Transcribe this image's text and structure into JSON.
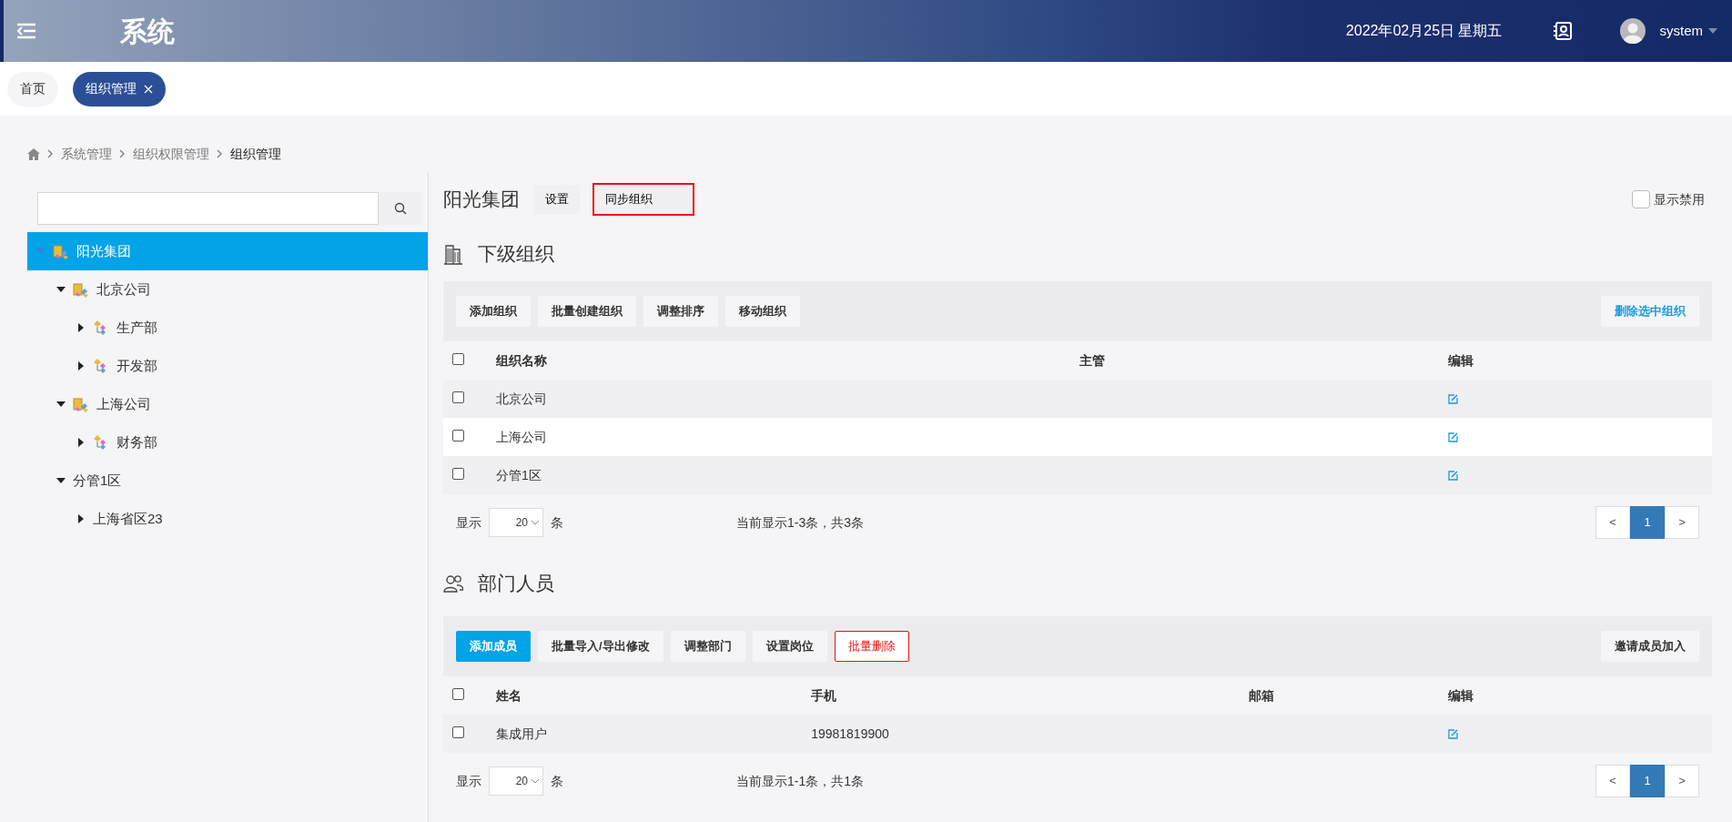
{
  "header": {
    "title": "系统",
    "date": "2022年02月25日 星期五",
    "user": "system"
  },
  "tabs": [
    {
      "label": "首页",
      "selected": false,
      "closable": false
    },
    {
      "label": "组织管理",
      "selected": true,
      "closable": true
    }
  ],
  "breadcrumb": [
    "系统管理",
    "组织权限管理",
    "组织管理"
  ],
  "tree": [
    {
      "label": "阳光集团",
      "kind": "company",
      "expanded": true,
      "selected": true,
      "children": [
        {
          "label": "北京公司",
          "kind": "company",
          "expanded": true,
          "selected": false,
          "children": [
            {
              "label": "生产部",
              "kind": "department",
              "expanded": false,
              "selected": false
            },
            {
              "label": "开发部",
              "kind": "department",
              "expanded": false,
              "selected": false
            }
          ]
        },
        {
          "label": "上海公司",
          "kind": "company",
          "expanded": true,
          "selected": false,
          "children": [
            {
              "label": "财务部",
              "kind": "department",
              "expanded": false,
              "selected": false
            }
          ]
        },
        {
          "label": "分管1区",
          "kind": "plain",
          "expanded": true,
          "selected": false,
          "children": [
            {
              "label": "上海省区23",
              "kind": "plain",
              "expanded": false,
              "selected": false
            }
          ]
        }
      ]
    }
  ],
  "org": {
    "title": "阳光集团",
    "actions": [
      {
        "label": "设置",
        "highlighted": false
      },
      {
        "label": "同步组织",
        "highlighted": true
      }
    ],
    "show_disabled": {
      "label": "显示禁用",
      "checked": false
    }
  },
  "sections": [
    {
      "title": "下级组织",
      "kind": "organizations",
      "toolbar_left": [
        {
          "label": "添加组织",
          "kind": "default"
        },
        {
          "label": "批量创建组织",
          "kind": "default"
        },
        {
          "label": "调整排序",
          "kind": "default"
        },
        {
          "label": "移动组织",
          "kind": "default"
        }
      ],
      "toolbar_right": [
        {
          "label": "删除选中组织",
          "kind": "link"
        }
      ],
      "select_all": false,
      "columns": [
        {
          "label": "组织名称",
          "kind": "text"
        },
        {
          "label": "主管",
          "kind": "text"
        },
        {
          "label": "编辑",
          "kind": "edit"
        }
      ],
      "rows": [
        {
          "cells": [
            "北京公司"
          ],
          "checked": false
        },
        {
          "cells": [
            "上海公司"
          ],
          "checked": false
        },
        {
          "cells": [
            "分管1区"
          ],
          "checked": false
        }
      ],
      "pager": {
        "show": "显示",
        "page_size": "20",
        "unit": "条",
        "summary": "当前显示1-3条，共3条",
        "prev": "<",
        "next": ">",
        "pages": [
          {
            "label": "1",
            "selected": true
          }
        ]
      }
    },
    {
      "title": "部门人员",
      "kind": "members",
      "toolbar_left": [
        {
          "label": "添加成员",
          "kind": "primary"
        },
        {
          "label": "批量导入/导出修改",
          "kind": "default"
        },
        {
          "label": "调整部门",
          "kind": "default"
        },
        {
          "label": "设置岗位",
          "kind": "default"
        },
        {
          "label": "批量删除",
          "kind": "danger"
        }
      ],
      "toolbar_right": [
        {
          "label": "邀请成员加入",
          "kind": "default"
        }
      ],
      "select_all": false,
      "columns": [
        {
          "label": "姓名",
          "kind": "text"
        },
        {
          "label": "手机",
          "kind": "text"
        },
        {
          "label": "邮箱",
          "kind": "text"
        },
        {
          "label": "编辑",
          "kind": "edit"
        }
      ],
      "rows": [
        {
          "cells": [
            "集成用户",
            "19981819900"
          ],
          "checked": false
        }
      ],
      "pager": {
        "show": "显示",
        "page_size": "20",
        "unit": "条",
        "summary": "当前显示1-1条，共1条",
        "prev": "<",
        "next": ">",
        "pages": [
          {
            "label": "1",
            "selected": true
          }
        ]
      }
    }
  ]
}
